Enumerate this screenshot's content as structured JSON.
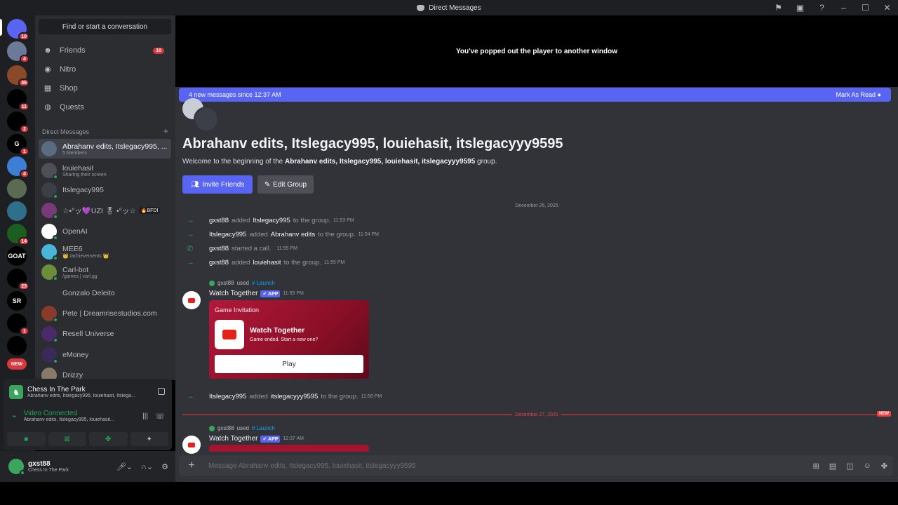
{
  "window": {
    "title": "Direct Messages"
  },
  "rail": {
    "servers": [
      {
        "label": "",
        "badge": "10",
        "color": "#5865f2"
      },
      {
        "label": "",
        "badge": "4",
        "color": "#6c7a99"
      },
      {
        "label": "",
        "badge": "46",
        "color": "#8a4a2a"
      },
      {
        "label": "",
        "badge": "11",
        "color": "#000000"
      },
      {
        "label": "",
        "badge": "2",
        "color": "#000000"
      },
      {
        "label": "G",
        "badge": "1",
        "color": "#000000"
      },
      {
        "label": "",
        "badge": "4",
        "color": "#3d7fd6"
      },
      {
        "label": "",
        "badge": "",
        "color": "#5b6b52"
      },
      {
        "label": "",
        "badge": "",
        "color": "#2f6f8a"
      },
      {
        "label": "",
        "badge": "14",
        "color": "#1b5e20"
      },
      {
        "label": "GOAT",
        "badge": "",
        "color": "#000000"
      },
      {
        "label": "",
        "badge": "23",
        "color": "#000000"
      },
      {
        "label": "SR",
        "badge": "",
        "color": "#000000"
      },
      {
        "label": "",
        "badge": "1",
        "color": "#000000"
      },
      {
        "label": "",
        "badge": "",
        "color": "#000000"
      },
      {
        "label": "NEW",
        "badge": "",
        "color": "#da373c"
      }
    ]
  },
  "sidebar": {
    "search_label": "Find or start a conversation",
    "nav": [
      {
        "label": "Friends",
        "icon": "friends-icon",
        "badge": "10"
      },
      {
        "label": "Nitro",
        "icon": "nitro-icon",
        "badge": ""
      },
      {
        "label": "Shop",
        "icon": "shop-icon",
        "badge": ""
      },
      {
        "label": "Quests",
        "icon": "quests-icon",
        "badge": ""
      }
    ],
    "dm_header": "Direct Messages",
    "dms": [
      {
        "name": "Abrahanv edits, Itslegacy995, ...",
        "sub": "5 Members",
        "color": "#5b6b80"
      },
      {
        "name": "louiehasit",
        "sub": "Sharing their screen",
        "color": "#4e5058"
      },
      {
        "name": "Itslegacy995",
        "sub": "",
        "color": "#3b4048"
      },
      {
        "name": "☆•°ッ💜UZI 🎖 •°ッ☆",
        "sub": "",
        "tag": "🔥BFDI",
        "color": "#7a3a7a"
      },
      {
        "name": "OpenAI",
        "sub": "",
        "color": "#ffffff"
      },
      {
        "name": "MEE6",
        "sub": "👑 /achievements 👑",
        "color": "#49b6d9"
      },
      {
        "name": "Carl-bot",
        "sub": "/games | carl.gg",
        "color": "#6b8e3a"
      },
      {
        "name": "Gonzalo Deleito",
        "sub": "",
        "color": "#2b2d31"
      },
      {
        "name": "Pete | Dreamrisestudios.com",
        "sub": "",
        "color": "#8a3a2a"
      },
      {
        "name": "Resell Universe",
        "sub": "",
        "color": "#4a2a6a"
      },
      {
        "name": "eMoney",
        "sub": "",
        "color": "#3a2a5a"
      },
      {
        "name": "Drizzy",
        "sub": "",
        "color": "#8a7a6a"
      }
    ]
  },
  "activity": {
    "game_name": "Chess In The Park",
    "game_sub": "Abrahanv edits, Itslegacy995, louiehasit, Itslega...",
    "voice_status": "Video Connected",
    "voice_sub": "Abrahanv edits, Itslegacy995, louiehasit..."
  },
  "user": {
    "name": "gxst88",
    "status": "Chess In The Park"
  },
  "chat": {
    "player_notice": "You've popped out the player to another window",
    "new_messages": "4 new messages since 12:37 AM",
    "mark_read": "Mark As Read",
    "group_title": "Abrahanv edits, Itslegacy995, louiehasit, itslegacyyy9595",
    "welcome_prefix": "Welcome to the beginning of the ",
    "welcome_group": "Abrahanv edits, Itslegacy995, louiehasit, itslegacyyy9595",
    "welcome_suffix": " group.",
    "invite_label": "Invite Friends",
    "edit_label": "Edit Group",
    "date1": "December 26, 2025",
    "date2": "December 27, 2025",
    "new_tag": "NEW",
    "system_messages": [
      {
        "user": "gxst88",
        "mid": "added",
        "target": "Itslegacy995",
        "end": "to the group.",
        "time": "11:53 PM",
        "icon": "→"
      },
      {
        "user": "Itslegacy995",
        "mid": "added",
        "target": "Abrahanv edits",
        "end": "to the group.",
        "time": "11:54 PM",
        "icon": "→"
      },
      {
        "user": "gxst88",
        "mid": "started a call.",
        "target": "",
        "end": "",
        "time": "11:55 PM",
        "icon": "✆"
      },
      {
        "user": "gxst88",
        "mid": "added",
        "target": "louiehasit",
        "end": "to the group.",
        "time": "11:55 PM",
        "icon": "→"
      }
    ],
    "used_user": "gxst88",
    "used_word": "used",
    "launch": "# Launch",
    "app_name": "Watch Together",
    "app_tag": "✔ APP",
    "app_time1": "11:55 PM",
    "card_title": "Game Invitation",
    "card_name": "Watch Together",
    "card_sub": "Game ended. Start a new one?",
    "card_play": "Play",
    "sys5": {
      "user": "Itslegacy995",
      "mid": "added",
      "target": "itslegacyyy9595",
      "end": "to the group.",
      "time": "11:59 PM"
    },
    "app_time2": "12:37 AM",
    "input_placeholder": "Message Abrahanv edits, Itslegacy995, louiehasit, itslegacyyy9595"
  }
}
